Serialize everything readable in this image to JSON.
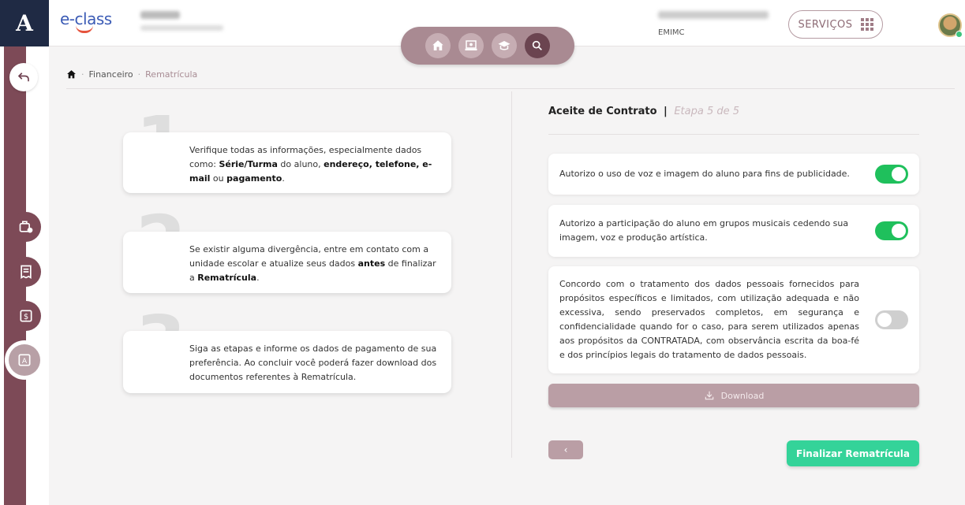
{
  "header": {
    "brand_letter": "A",
    "logo_text": "e-class",
    "user_subtitle": "EMIMC",
    "services_label": "SERVIÇOS"
  },
  "nav_icons": [
    "home-icon",
    "presentation-icon",
    "graduation-icon",
    "search-icon"
  ],
  "sidebar": {
    "items": [
      {
        "icon": "briefcase-clock-icon"
      },
      {
        "icon": "receipt-icon"
      },
      {
        "icon": "dollar-document-icon"
      },
      {
        "icon": "enrollment-icon",
        "active": true
      }
    ]
  },
  "breadcrumb": {
    "items": [
      "Financeiro",
      "Rematrícula"
    ]
  },
  "steps": [
    {
      "number": "1",
      "parts": [
        "Verifique todas as informações, especialmente dados como: ",
        "Série/Turma",
        " do aluno, ",
        "endereço, telefone, e-mail",
        " ou ",
        "pagamento",
        "."
      ]
    },
    {
      "number": "2",
      "parts": [
        "Se existir alguma divergência, entre em contato com a unidade escolar e atualize seus dados ",
        "antes",
        " de finalizar a ",
        "Rematrícula",
        "."
      ]
    },
    {
      "number": "3",
      "text": "Siga as etapas e informe os dados de pagamento de sua preferência. Ao concluir você poderá fazer download dos documentos referentes à Rematrícula."
    }
  ],
  "contract": {
    "title": "Aceite de Contrato",
    "separator": "|",
    "stage": "Etapa 5 de 5",
    "items": [
      {
        "text": "Autorizo o uso de voz e imagem do aluno para fins de publicidade.",
        "checked": true
      },
      {
        "text": "Autorizo a participação do aluno em grupos musicais cedendo sua imagem, voz e produção artística.",
        "checked": true
      },
      {
        "text": "Concordo com o tratamento dos dados pessoais fornecidos para propósitos específicos e limitados, com utilização adequada e não excessiva, sendo preservados completos, em segurança e confidencialidade quando for o caso, para serem utilizados apenas aos propósitos da CONTRATADA, com observância escrita da boa-fé e dos princípios legais do tratamento de dados pessoais.",
        "checked": false
      }
    ],
    "download_label": "Download",
    "prev_label": "‹",
    "finish_label": "Finalizar Rematrícula"
  },
  "colors": {
    "brand_dark": "#1f2a44",
    "accent_mauve": "#7d4a57",
    "toggle_on": "#1fc05c",
    "finish_green": "#34d399"
  }
}
